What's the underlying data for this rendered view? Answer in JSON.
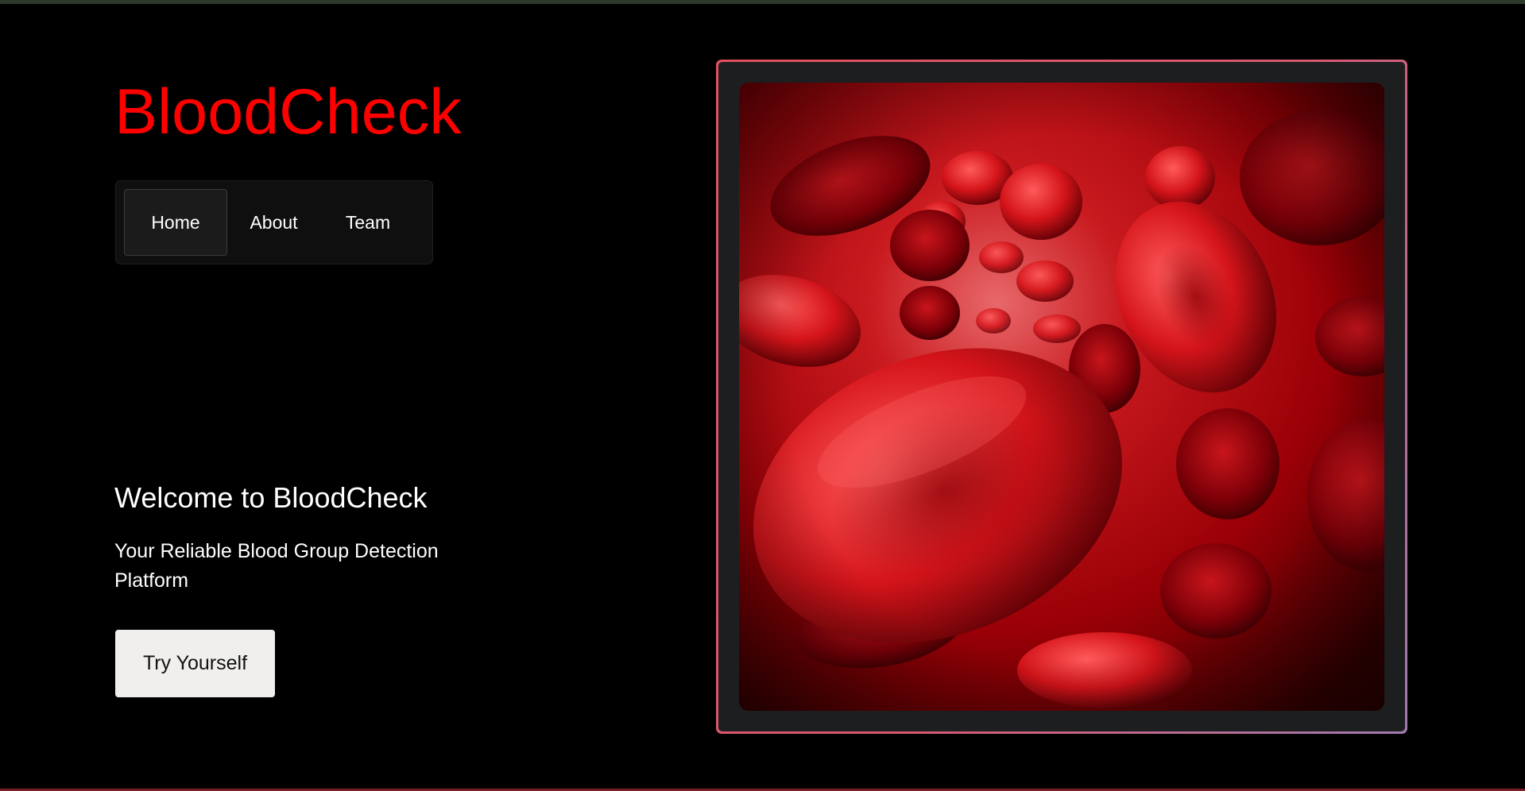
{
  "brand": {
    "title": "BloodCheck"
  },
  "nav": {
    "items": [
      {
        "label": "Home",
        "active": true
      },
      {
        "label": "About",
        "active": false
      },
      {
        "label": "Team",
        "active": false
      }
    ]
  },
  "hero": {
    "heading": "Welcome to BloodCheck",
    "subheading": "Your Reliable Blood Group Detection Platform",
    "cta_label": "Try Yourself",
    "image_icon": "red-blood-cells-image"
  },
  "colors": {
    "brand": "#ff0000",
    "background": "#000000",
    "nav_bg": "#0f0f0f",
    "cta_bg": "#f0efed",
    "frame_gradient_start": "#e0505e",
    "frame_gradient_end": "#a07aae"
  }
}
